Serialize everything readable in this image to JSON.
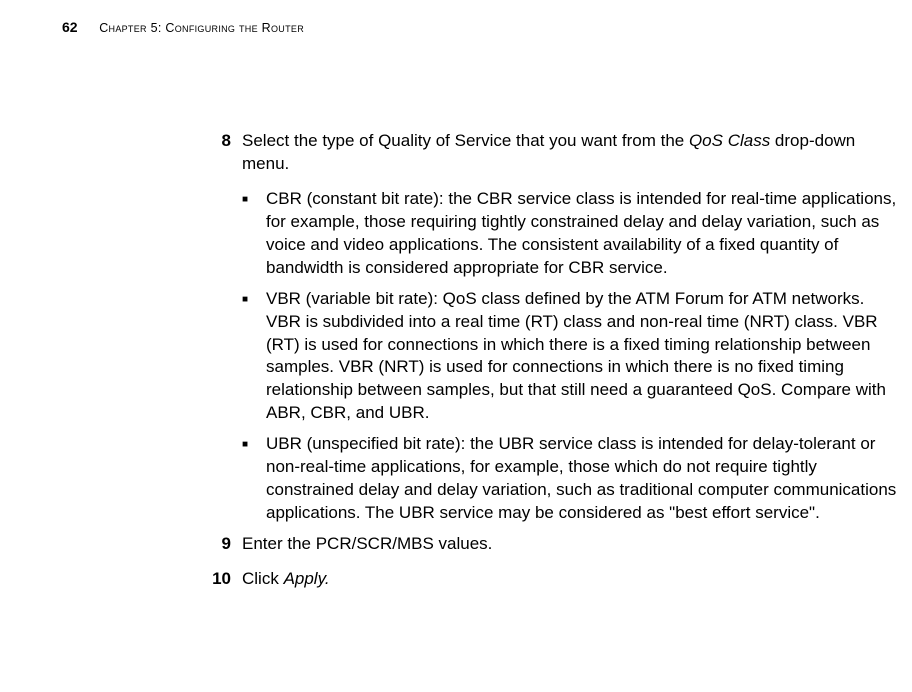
{
  "header": {
    "page_number": "62",
    "chapter_label": "Chapter 5: Configuring the Router"
  },
  "steps": {
    "s8": {
      "num": "8",
      "text_pre": "Select the type of Quality of Service that you want from the ",
      "text_italic": "QoS Class",
      "text_post": " drop-down menu."
    },
    "s9": {
      "num": "9",
      "text": "Enter the PCR/SCR/MBS values."
    },
    "s10": {
      "num": "10",
      "text_pre": "Click ",
      "text_italic": "Apply."
    }
  },
  "bullets": {
    "b1": "CBR (constant bit rate): the CBR service class is intended for real-time applications, for example, those requiring tightly constrained delay and delay variation, such as voice and video applications. The consistent availability of a fixed quantity of bandwidth is considered appropriate for CBR service.",
    "b2": "VBR (variable bit rate): QoS class defined by the ATM Forum for ATM networks. VBR is subdivided into a real time (RT) class and non-real time (NRT) class. VBR (RT) is used for connections in which there is a fixed timing relationship between samples. VBR (NRT) is used for connections in which there is no fixed timing relationship between samples, but that still need a guaranteed QoS. Compare with ABR, CBR, and UBR.",
    "b3": "UBR (unspecified bit rate): the UBR service class is intended for delay-tolerant or non-real-time applications, for example, those which do not require tightly constrained delay and delay variation, such as traditional computer communications applications. The UBR service may be considered as \"best effort service\"."
  }
}
